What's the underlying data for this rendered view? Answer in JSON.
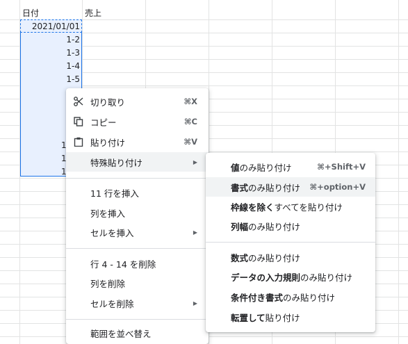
{
  "sheet": {
    "col_headers": [
      "日付",
      "売上"
    ],
    "cells": [
      "2021/01/01",
      "1-2",
      "1-3",
      "1-4",
      "1-5"
    ],
    "partial": [
      "1",
      "1",
      "1"
    ]
  },
  "context_menu": {
    "items": [
      {
        "label": "切り取り",
        "shortcut": "⌘X",
        "icon": "scissors-icon"
      },
      {
        "label": "コピー",
        "shortcut": "⌘C",
        "icon": "copy-icon"
      },
      {
        "label": "貼り付け",
        "shortcut": "⌘V",
        "icon": "clipboard-icon"
      },
      {
        "label": "特殊貼り付け",
        "submenu_arrow": "▶"
      },
      {
        "label": "11 行を挿入"
      },
      {
        "label": "列を挿入"
      },
      {
        "label": "セルを挿入",
        "submenu_arrow": "▶"
      },
      {
        "label": "行 4 - 14 を削除"
      },
      {
        "label": "列を削除"
      },
      {
        "label": "セルを削除",
        "submenu_arrow": "▶"
      },
      {
        "label": "範囲を並べ替え"
      }
    ]
  },
  "paste_special_menu": {
    "items": [
      {
        "bold": "値",
        "rest": "のみ貼り付け",
        "shortcut": "⌘+Shift+V"
      },
      {
        "bold": "書式",
        "rest": "のみ貼り付け",
        "shortcut": "⌘+option+V"
      },
      {
        "bold": "枠線を除く",
        "rest": "すべてを貼り付け"
      },
      {
        "bold": "列幅",
        "rest": "のみ貼り付け"
      },
      {
        "bold": "数式",
        "rest": "のみ貼り付け"
      },
      {
        "bold": "データの入力規則",
        "rest": "のみ貼り付け"
      },
      {
        "bold": "条件付き書式",
        "rest": "のみ貼り付け"
      },
      {
        "bold": "転置して",
        "rest": "貼り付け"
      }
    ]
  }
}
